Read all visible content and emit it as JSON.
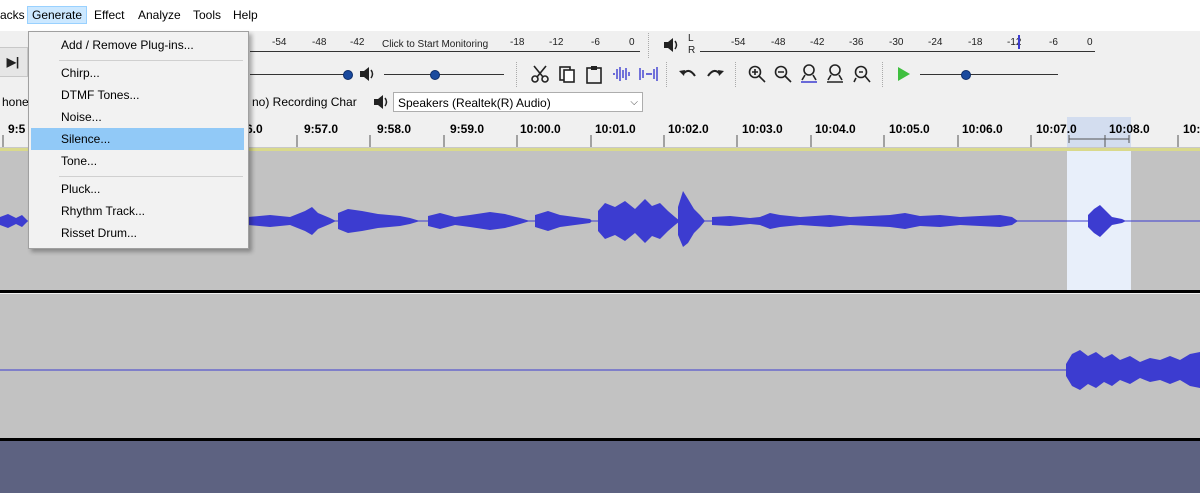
{
  "menubar": {
    "items": [
      "acks",
      "Generate",
      "Effect",
      "Analyze",
      "Tools",
      "Help"
    ],
    "active": "Generate"
  },
  "generate_menu": {
    "items": [
      {
        "label": "Add / Remove Plug-ins..."
      },
      {
        "label": "Chirp..."
      },
      {
        "label": "DTMF Tones..."
      },
      {
        "label": "Noise..."
      },
      {
        "label": "Silence...",
        "highlighted": true
      },
      {
        "label": "Tone..."
      },
      {
        "label": "Pluck..."
      },
      {
        "label": "Rhythm Track..."
      },
      {
        "label": "Risset Drum..."
      }
    ]
  },
  "recording_meter": {
    "ticks": [
      "-54",
      "-48",
      "-42",
      "-18",
      "-12",
      "-6",
      "0"
    ],
    "monitor_label": "Click to Start Monitoring"
  },
  "playback_meter": {
    "channel_l": "L",
    "channel_r": "R",
    "ticks": [
      "-54",
      "-48",
      "-42",
      "-36",
      "-30",
      "-24",
      "-18",
      "-12",
      "-6",
      "0"
    ]
  },
  "device_bar": {
    "input_device": "hone",
    "recording_channels": "no) Recording Char",
    "output_device": "Speakers (Realtek(R) Audio)"
  },
  "ruler": {
    "labels": [
      "9:5",
      "6.0",
      "9:57.0",
      "9:58.0",
      "9:59.0",
      "10:00.0",
      "10:01.0",
      "10:02.0",
      "10:03.0",
      "10:04.0",
      "10:05.0",
      "10:06.0",
      "10:07.0",
      "10:08.0",
      "10:"
    ]
  },
  "transport": {
    "skip_end_label": "▶|"
  },
  "icons": {
    "cut": "scissors-icon",
    "copy": "copy-icon",
    "paste": "paste-icon",
    "trim": "trim-audio-icon",
    "silence": "silence-audio-icon",
    "undo": "undo-icon",
    "redo": "redo-icon",
    "zoom_in": "zoom-in-icon",
    "zoom_out": "zoom-out-icon",
    "fit_selection": "fit-selection-icon",
    "fit_project": "fit-project-icon",
    "zoom_toggle": "zoom-toggle-icon",
    "play_at_speed": "play-at-speed-icon"
  },
  "colors": {
    "waveform": "#3c3cd0",
    "track_bg": "#c2c2c2",
    "selection": "#e8effa",
    "menu_highlight": "#91c9f7",
    "bottom_area": "#5d6281"
  }
}
